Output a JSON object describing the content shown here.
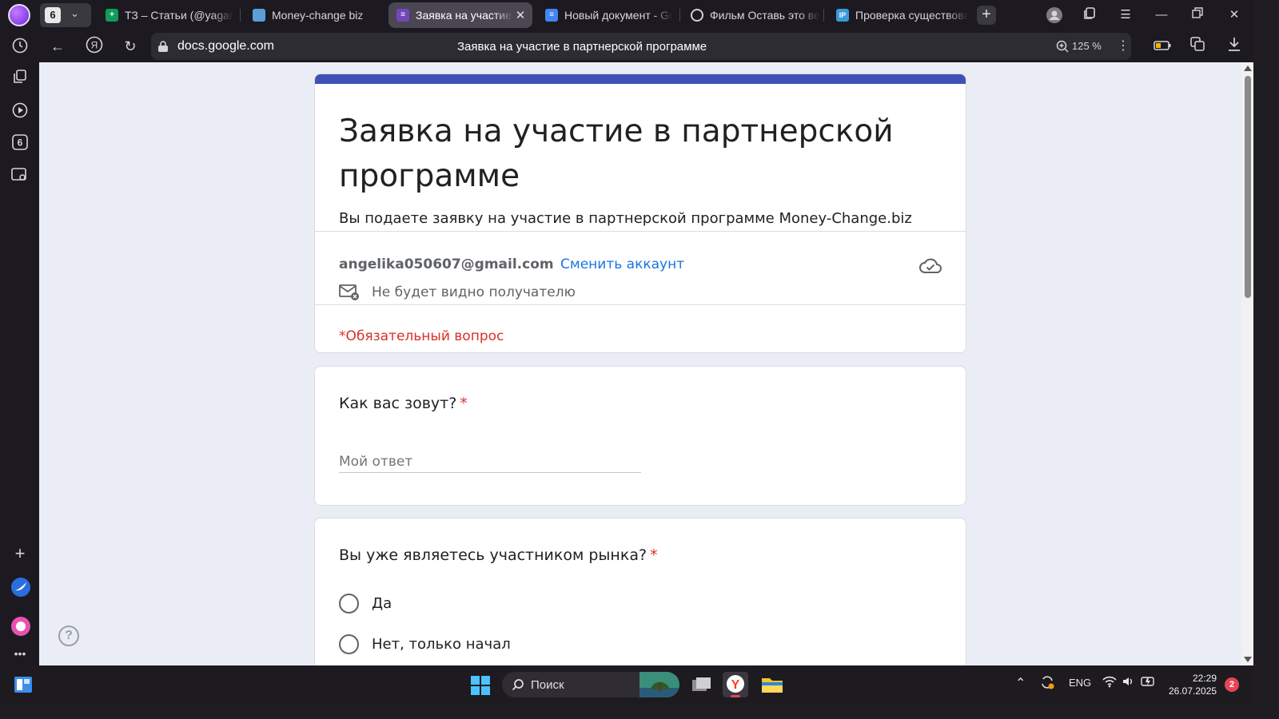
{
  "browser": {
    "tab_group_count": "6",
    "tabs": [
      {
        "label": "ТЗ – Статьи (@yagam",
        "icon": "sheets-icon",
        "color": "#0f9d58",
        "active": false
      },
      {
        "label": "Money-change biz",
        "icon": "site-favicon",
        "color": "#5aa0d8",
        "active": false
      },
      {
        "label": "Заявка на участие в",
        "icon": "forms-icon",
        "color": "#7248b9",
        "active": true
      },
      {
        "label": "Новый документ - Goo",
        "icon": "docs-icon",
        "color": "#4285f4",
        "active": false
      },
      {
        "label": "Фильм Оставь это ве",
        "icon": "film-icon",
        "color": "#cfcfd4",
        "active": false
      },
      {
        "label": "Проверка существова",
        "icon": "ip-icon",
        "color": "#3a9ad9",
        "active": false
      }
    ],
    "address": {
      "domain": "docs.google.com",
      "page_title": "Заявка на участие в партнерской программе"
    },
    "zoom": "125 %"
  },
  "form": {
    "accent_color": "#3f51b5",
    "title": "Заявка на участие в партнерской программе",
    "description": "Вы подаете заявку на участие в партнерской программе Money-Change.biz",
    "account_email": "angelika050607@gmail.com",
    "switch_account_label": "Сменить аккаунт",
    "email_hidden_note": "Не будет видно получателю",
    "required_note": "*Обязательный вопрос",
    "questions": [
      {
        "title": "Как вас зовут?",
        "required_mark": "*",
        "type": "text",
        "placeholder": "Мой ответ"
      },
      {
        "title": "Вы уже являетесь участником рынка?",
        "required_mark": "*",
        "type": "radio",
        "options": [
          "Да",
          "Нет, только начал"
        ]
      }
    ]
  },
  "help_icon": "?",
  "taskbar": {
    "search_label": "Поиск",
    "language": "ENG",
    "time": "22:29",
    "date": "26.07.2025",
    "notification_count": "2"
  }
}
